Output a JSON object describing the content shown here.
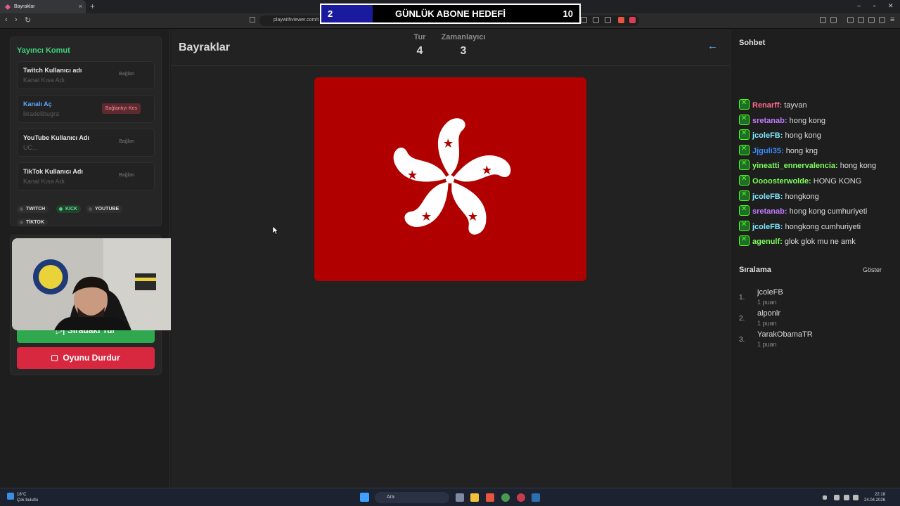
{
  "browser": {
    "tab_title": "Bayraklar",
    "url": "playwithviewer.com/t"
  },
  "goal_overlay": {
    "current": "2",
    "title": "GÜNLÜK ABONE HEDEFİ",
    "target": "10",
    "progress_fraction": 0.2
  },
  "left_panel": {
    "title": "Yayıncı Komut",
    "rows": [
      {
        "label": "Twitch Kullanıcı adı",
        "placeholder": "Kanal Kısa Adı",
        "action": "Bağlan"
      },
      {
        "label": "Kanalı Aç",
        "placeholder": "liiradelibugra",
        "action": "Bağlantıyı Kes"
      },
      {
        "label": "YouTube Kullanıcı Adı",
        "placeholder": "UC...",
        "action": "Bağlan"
      },
      {
        "label": "TikTok Kullanıcı Adı",
        "placeholder": "Kanal Kısa Adı",
        "action": "Bağlan"
      }
    ],
    "platforms": [
      "TWITCH",
      "KICK",
      "YOUTUBE",
      "TİKTOK"
    ],
    "next_round": "Sıradaki Tur",
    "stop_game": "Oyunu Durdur"
  },
  "main": {
    "title": "Bayraklar",
    "round_label": "Tur",
    "round_value": "4",
    "timer_label": "Zamanlayıcı",
    "timer_value": "3"
  },
  "chat": {
    "title": "Sohbet",
    "messages": [
      {
        "user": "Renarff:",
        "text": "tayvan",
        "color": "#ff6b8b"
      },
      {
        "user": "sretanab:",
        "text": "hong kong",
        "color": "#c27bff"
      },
      {
        "user": "jcoleFB:",
        "text": "hong kong",
        "color": "#7ee8ff"
      },
      {
        "user": "Jjguli35:",
        "text": "hong kng",
        "color": "#3a8dff"
      },
      {
        "user": "yineatti_ennervalencia:",
        "text": "hong kong",
        "color": "#7dff5b"
      },
      {
        "user": "Oooosterwolde:",
        "text": "HONG KONG",
        "color": "#7dff5b"
      },
      {
        "user": "jcoleFB:",
        "text": "hongkong",
        "color": "#7ee8ff"
      },
      {
        "user": "sretanab:",
        "text": "hong kong cumhuriyeti",
        "color": "#c27bff"
      },
      {
        "user": "jcoleFB:",
        "text": "hongkong cumhuriyeti",
        "color": "#7ee8ff"
      },
      {
        "user": "agenulf:",
        "text": "glok glok mu ne amk",
        "color": "#7dff5b"
      }
    ]
  },
  "ranking": {
    "title": "Sıralama",
    "show": "Göster",
    "entries": [
      {
        "rank": "1.",
        "name": "jcoleFB",
        "points": "1 puan"
      },
      {
        "rank": "2.",
        "name": "alponlr",
        "points": "1 puan"
      },
      {
        "rank": "3.",
        "name": "YarakObamaTR",
        "points": "1 puan"
      }
    ]
  },
  "taskbar": {
    "weather_temp": "18°C",
    "weather_desc": "Çok bulutlu",
    "search": "Ara",
    "time": "22:18",
    "date": "24.04.2026"
  }
}
